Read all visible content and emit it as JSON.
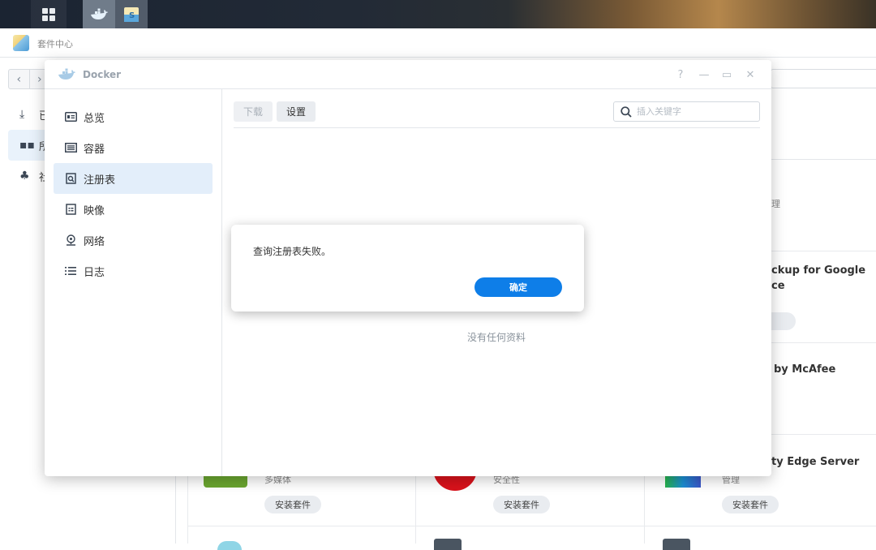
{
  "taskbar": {
    "main_menu_icon": "grid-icon",
    "apps": [
      "docker-icon",
      "package-center-icon"
    ]
  },
  "package_center": {
    "title": "套件中心",
    "sidebar": [
      {
        "label": "已",
        "icon": "download-icon"
      },
      {
        "label": "所",
        "icon": "apps-icon"
      },
      {
        "label": "社",
        "icon": "community-icon"
      }
    ],
    "cards": {
      "r1c3_fragment": "理",
      "r2c3_title": "ckup for Google",
      "r2c3_title2": "ce",
      "r3c3_title": "by McAfee",
      "r4c3_title": "ty Edge Server",
      "r4c1_category": "多媒体",
      "r4c2_category": "安全性",
      "r4c3_category": "管理",
      "install_label": "安装套件"
    }
  },
  "docker": {
    "title": "Docker",
    "controls": {
      "help": "?",
      "minimize": "—",
      "maximize": "▭",
      "close": "✕"
    },
    "sidebar": [
      {
        "label": "总览",
        "icon": "overview-icon"
      },
      {
        "label": "容器",
        "icon": "container-icon"
      },
      {
        "label": "注册表",
        "icon": "registry-icon"
      },
      {
        "label": "映像",
        "icon": "image-icon"
      },
      {
        "label": "网络",
        "icon": "network-icon"
      },
      {
        "label": "日志",
        "icon": "log-icon"
      }
    ],
    "active_item": "注册表",
    "toolbar": {
      "download": "下载",
      "settings": "设置"
    },
    "search": {
      "placeholder": "插入关键字",
      "value": ""
    },
    "empty_text": "没有任何资料"
  },
  "dialog": {
    "message": "查询注册表失败。",
    "ok_label": "确定"
  },
  "colors": {
    "accent": "#0e7ee8",
    "active_bg": "#e3eefa"
  }
}
